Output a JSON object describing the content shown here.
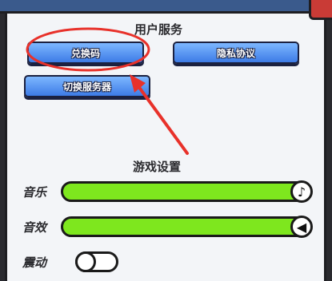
{
  "user_services": {
    "title": "用户服务",
    "redeem_label": "兑换码",
    "privacy_label": "隐私协议",
    "switch_server_label": "切换服务器"
  },
  "game_settings": {
    "title": "游戏设置",
    "music_label": "音乐",
    "music_level": 1.0,
    "sfx_label": "音效",
    "sfx_level": 1.0,
    "vibration_label": "震动",
    "vibration_on": false
  },
  "icons": {
    "music_knob": "music-note-icon",
    "sfx_knob": "speaker-icon"
  },
  "colors": {
    "button_blue": "#3d7be6",
    "slider_green": "#7ee71e",
    "annotation_red": "#e8312a"
  }
}
